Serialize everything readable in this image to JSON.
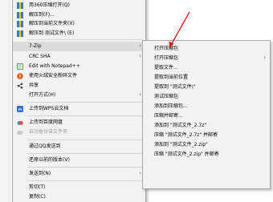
{
  "main_menu": {
    "items": [
      {
        "label": "用360压缩打开(Q)",
        "icon": "archive-icon"
      },
      {
        "label": "解压到(F)...",
        "icon": "archive-icon"
      },
      {
        "label": "解压到当前文件夹(X)",
        "icon": "archive-icon"
      },
      {
        "label": "解压到 测试文件\\ (E)",
        "icon": "archive-icon"
      },
      {
        "label": "7-Zip"
      },
      {
        "label": "CRC SHA"
      },
      {
        "label": "Edit with Notepad++",
        "icon": "notepad-icon"
      },
      {
        "label": "使用火绒安全粉碎文件",
        "icon": "shield-icon"
      },
      {
        "label": "共享",
        "icon": "share-icon"
      },
      {
        "label": "打开方式(H)"
      },
      {
        "label": "上传到WPS云文档",
        "icon": "wps-cloud-icon"
      },
      {
        "label": "上传到百度网盘",
        "icon": "baidu-cloud-icon"
      },
      {
        "label": "自动备份该文件夹",
        "icon": "backup-icon"
      },
      {
        "label": "通过QQ发送到"
      },
      {
        "label": "还原以前的版本(V)"
      },
      {
        "label": "发送到(N)"
      },
      {
        "label": "剪切(T)"
      },
      {
        "label": "复制(C)"
      }
    ]
  },
  "submenu_7zip": {
    "items": [
      "打开压缩包",
      "打开压缩包",
      "提取文件...",
      "提取到当前位置",
      "提取到 \"测试文件\\\"",
      "测试压缩包",
      "添加到压缩包...",
      "压缩并邮寄...",
      "添加到 \"测试文件_2.7z\"",
      "压缩 \"测试文件_2.7z\" 并邮寄",
      "添加到 \"测试文件_2.zip\"",
      "压缩 \"测试文件_2.zip\" 并邮寄"
    ]
  },
  "colors": {
    "menu_bg": "#f2f2f2",
    "highlight": "#dcdcdc",
    "annotation_arrow": "#e02020"
  }
}
